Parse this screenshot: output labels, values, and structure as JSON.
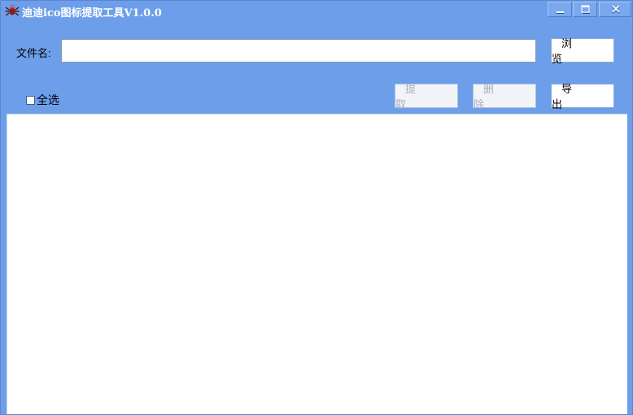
{
  "window": {
    "title": "迪迪ico图标提取工具V1.0.0",
    "app_icon": "spider-icon",
    "controls": [
      "minimize-icon",
      "maximize-icon",
      "close-icon"
    ]
  },
  "file_row": {
    "label": "文件名:",
    "value": "",
    "placeholder": "",
    "browse_label": "浏 览"
  },
  "toolbar": {
    "select_all_label": "全选",
    "select_all_checked": false,
    "extract_label": "提 取",
    "delete_label": "删 除",
    "export_label": "导 出"
  },
  "colors": {
    "window_bg": "#6d9eea",
    "list_bg": "#ffffff",
    "disabled_text": "#a8b0bd"
  }
}
